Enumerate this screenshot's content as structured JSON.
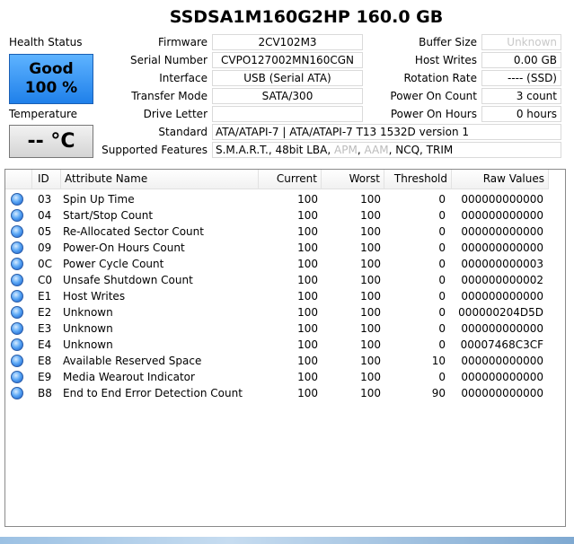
{
  "drive": {
    "title": "SSDSA1M160G2HP  160.0 GB"
  },
  "status": {
    "health_label": "Health Status",
    "health_word": "Good",
    "health_pct": "100 %",
    "temp_label": "Temperature",
    "temp_value": "-- °C"
  },
  "info_left": {
    "firmware_label": "Firmware",
    "firmware": "2CV102M3",
    "serial_label": "Serial Number",
    "serial": "CVPO127002MN160CGN",
    "interface_label": "Interface",
    "interface": "USB (Serial ATA)",
    "transfer_label": "Transfer Mode",
    "transfer": "SATA/300",
    "letter_label": "Drive Letter",
    "letter": "",
    "standard_label": "Standard",
    "standard": "ATA/ATAPI-7 | ATA/ATAPI-7 T13 1532D version 1",
    "features_label": "Supported Features"
  },
  "features": [
    {
      "text": "S.M.A.R.T.",
      "enabled": true
    },
    {
      "text": "48bit LBA",
      "enabled": true
    },
    {
      "text": "APM",
      "enabled": false
    },
    {
      "text": "AAM",
      "enabled": false
    },
    {
      "text": "NCQ",
      "enabled": true
    },
    {
      "text": "TRIM",
      "enabled": true
    }
  ],
  "info_right": {
    "buffer_label": "Buffer Size",
    "buffer": "Unknown",
    "hostwrites_label": "Host Writes",
    "hostwrites": "0.00 GB",
    "rotation_label": "Rotation Rate",
    "rotation": "---- (SSD)",
    "powercount_label": "Power On Count",
    "powercount": "3 count",
    "powerhours_label": "Power On Hours",
    "powerhours": "0 hours"
  },
  "table": {
    "headers": {
      "id": "ID",
      "name": "Attribute Name",
      "current": "Current",
      "worst": "Worst",
      "threshold": "Threshold",
      "raw": "Raw Values"
    },
    "rows": [
      {
        "id": "03",
        "name": "Spin Up Time",
        "current": "100",
        "worst": "100",
        "threshold": "0",
        "raw": "000000000000"
      },
      {
        "id": "04",
        "name": "Start/Stop Count",
        "current": "100",
        "worst": "100",
        "threshold": "0",
        "raw": "000000000000"
      },
      {
        "id": "05",
        "name": "Re-Allocated Sector Count",
        "current": "100",
        "worst": "100",
        "threshold": "0",
        "raw": "000000000000"
      },
      {
        "id": "09",
        "name": "Power-On Hours Count",
        "current": "100",
        "worst": "100",
        "threshold": "0",
        "raw": "000000000000"
      },
      {
        "id": "0C",
        "name": "Power Cycle Count",
        "current": "100",
        "worst": "100",
        "threshold": "0",
        "raw": "000000000003"
      },
      {
        "id": "C0",
        "name": "Unsafe Shutdown Count",
        "current": "100",
        "worst": "100",
        "threshold": "0",
        "raw": "000000000002"
      },
      {
        "id": "E1",
        "name": "Host Writes",
        "current": "100",
        "worst": "100",
        "threshold": "0",
        "raw": "000000000000"
      },
      {
        "id": "E2",
        "name": "Unknown",
        "current": "100",
        "worst": "100",
        "threshold": "0",
        "raw": "000000204D5D"
      },
      {
        "id": "E3",
        "name": "Unknown",
        "current": "100",
        "worst": "100",
        "threshold": "0",
        "raw": "000000000000"
      },
      {
        "id": "E4",
        "name": "Unknown",
        "current": "100",
        "worst": "100",
        "threshold": "0",
        "raw": "00007468C3CF"
      },
      {
        "id": "E8",
        "name": "Available Reserved Space",
        "current": "100",
        "worst": "100",
        "threshold": "10",
        "raw": "000000000000"
      },
      {
        "id": "E9",
        "name": "Media Wearout Indicator",
        "current": "100",
        "worst": "100",
        "threshold": "0",
        "raw": "000000000000"
      },
      {
        "id": "B8",
        "name": "End to End Error Detection Count",
        "current": "100",
        "worst": "100",
        "threshold": "90",
        "raw": "000000000000"
      }
    ]
  },
  "colors": {
    "health": "#3d9bff",
    "status_dot": "#2f7be0"
  }
}
